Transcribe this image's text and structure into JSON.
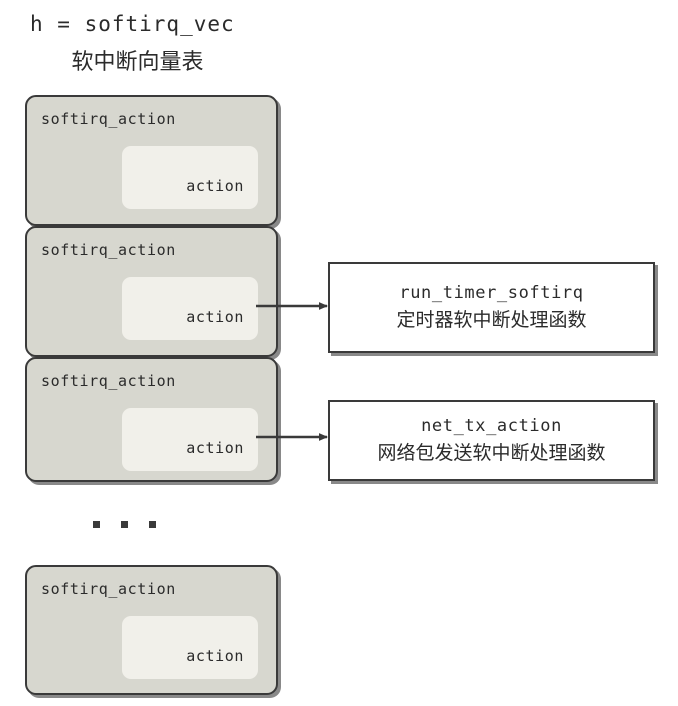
{
  "title": {
    "expression": "h = softirq_vec",
    "chinese": "软中断向量表"
  },
  "colors": {
    "slot_fill": "#d7d7cf",
    "action_fill": "#f1f0ea",
    "border": "#3a3a3a",
    "text": "#2b2b2b",
    "handler_fill": "#ffffff",
    "page_background": "#ffffff"
  },
  "slots": [
    {
      "struct_label": "softirq_action",
      "action_label": "action"
    },
    {
      "struct_label": "softirq_action",
      "action_label": "action"
    },
    {
      "struct_label": "softirq_action",
      "action_label": "action"
    },
    {
      "struct_label": "softirq_action",
      "action_label": "action"
    }
  ],
  "ellipsis": {
    "dots": [
      "dot",
      "dot",
      "dot"
    ]
  },
  "handlers": [
    {
      "function_name": "run_timer_softirq",
      "description": "定时器软中断处理函数"
    },
    {
      "function_name": "net_tx_action",
      "description": "网络包发送软中断处理函数"
    }
  ]
}
